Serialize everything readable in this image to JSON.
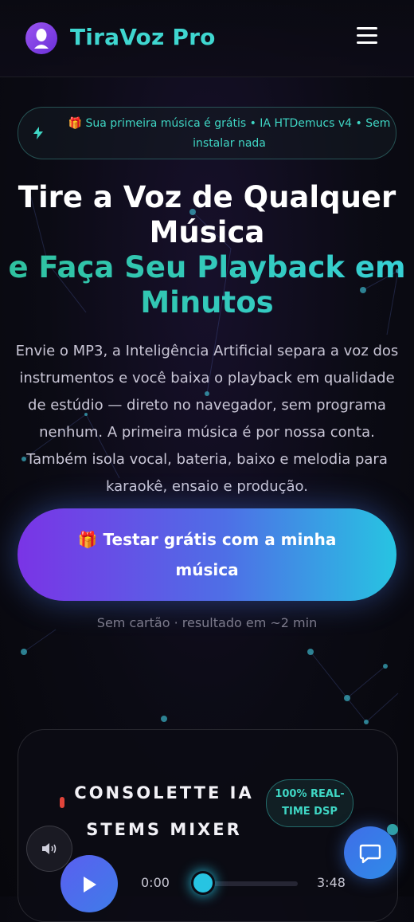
{
  "header": {
    "brand": "TiraVoz Pro",
    "logo_icon": "singer-silhouette-icon",
    "menu_icon": "hamburger-menu-icon"
  },
  "promo": {
    "icon": "lightning-bolt-icon",
    "text": "🎁 Sua primeira música é grátis • IA HTDemucs v4 • Sem instalar nada"
  },
  "hero": {
    "title_line1": "Tire a Voz de Qualquer Música",
    "title_line2": "e Faça Seu Playback em Minutos",
    "description": "Envie o MP3, a Inteligência Artificial separa a voz dos instrumentos e você baixa o playback em qualidade de estúdio — direto no navegador, sem programa nenhum. A primeira música é por nossa conta. Também isola vocal, bateria, baixo e melodia para karaokê, ensaio e produção.",
    "cta_label": "🎁 Testar grátis com a minha música",
    "cta_note": "Sem cartão · resultado em ~2 min"
  },
  "mixer": {
    "title": "CONSOLETTE IA STEMS MIXER",
    "badge": "100% REAL-TIME DSP",
    "time_current": "0:00",
    "time_total": "3:48",
    "progress": 0,
    "volume_icon": "volume-icon",
    "play_icon": "play-icon"
  },
  "chat": {
    "icon": "chat-bubble-icon"
  },
  "colors": {
    "accent_teal": "#3fd6d0",
    "accent_purple": "#7a34e6",
    "accent_cyan": "#27c4e2"
  }
}
